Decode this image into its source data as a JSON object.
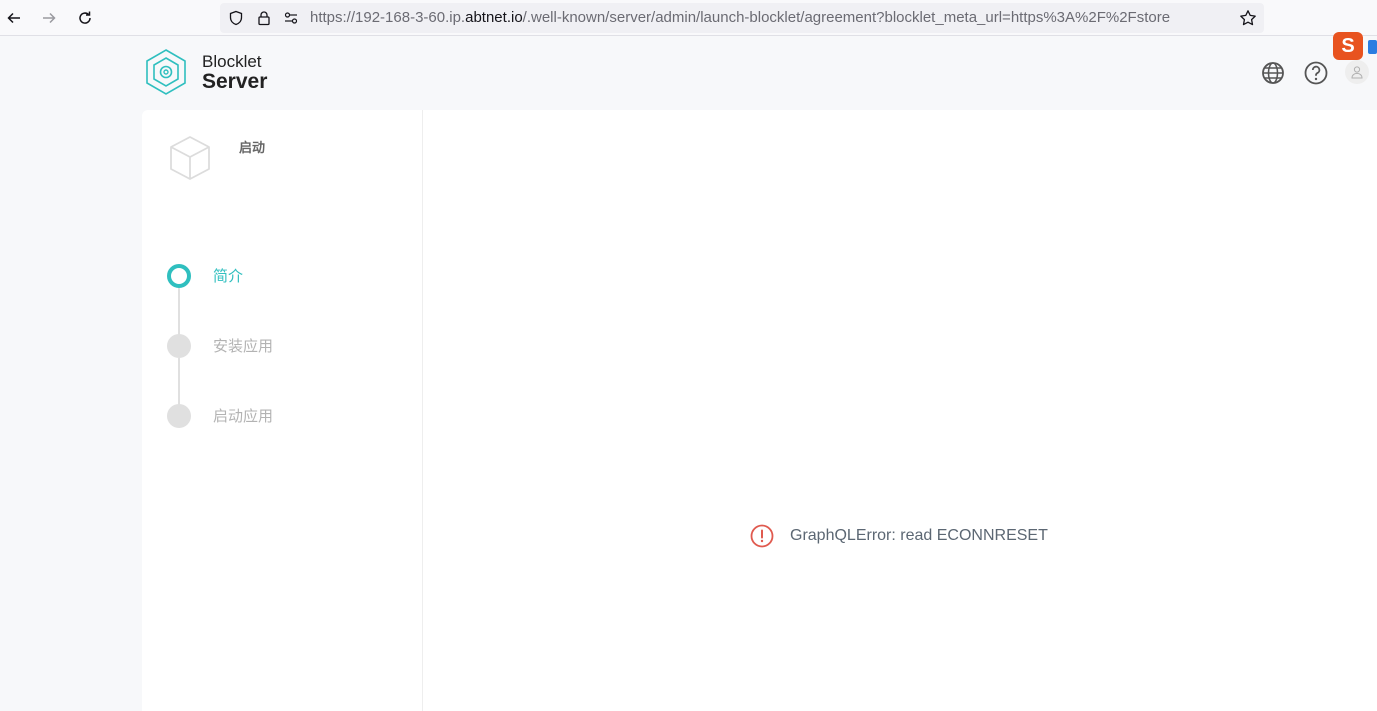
{
  "browser": {
    "url_prefix": "https://192-168-3-60.ip.",
    "url_host": "abtnet.io",
    "url_suffix": "/.well-known/server/admin/launch-blocklet/agreement?blocklet_meta_url=https%3A%2F%2Fstore",
    "extension_letter": "S"
  },
  "header": {
    "brand_line1": "Blocklet",
    "brand_line2": "Server"
  },
  "sidebar": {
    "app_title": "启动",
    "steps": [
      {
        "label": "简介",
        "active": true
      },
      {
        "label": "安装应用",
        "active": false
      },
      {
        "label": "启动应用",
        "active": false
      }
    ]
  },
  "main": {
    "error_message": "GraphQLError: read ECONNRESET"
  },
  "colors": {
    "accent": "#2fbfbf",
    "error": "#e05a4f"
  }
}
